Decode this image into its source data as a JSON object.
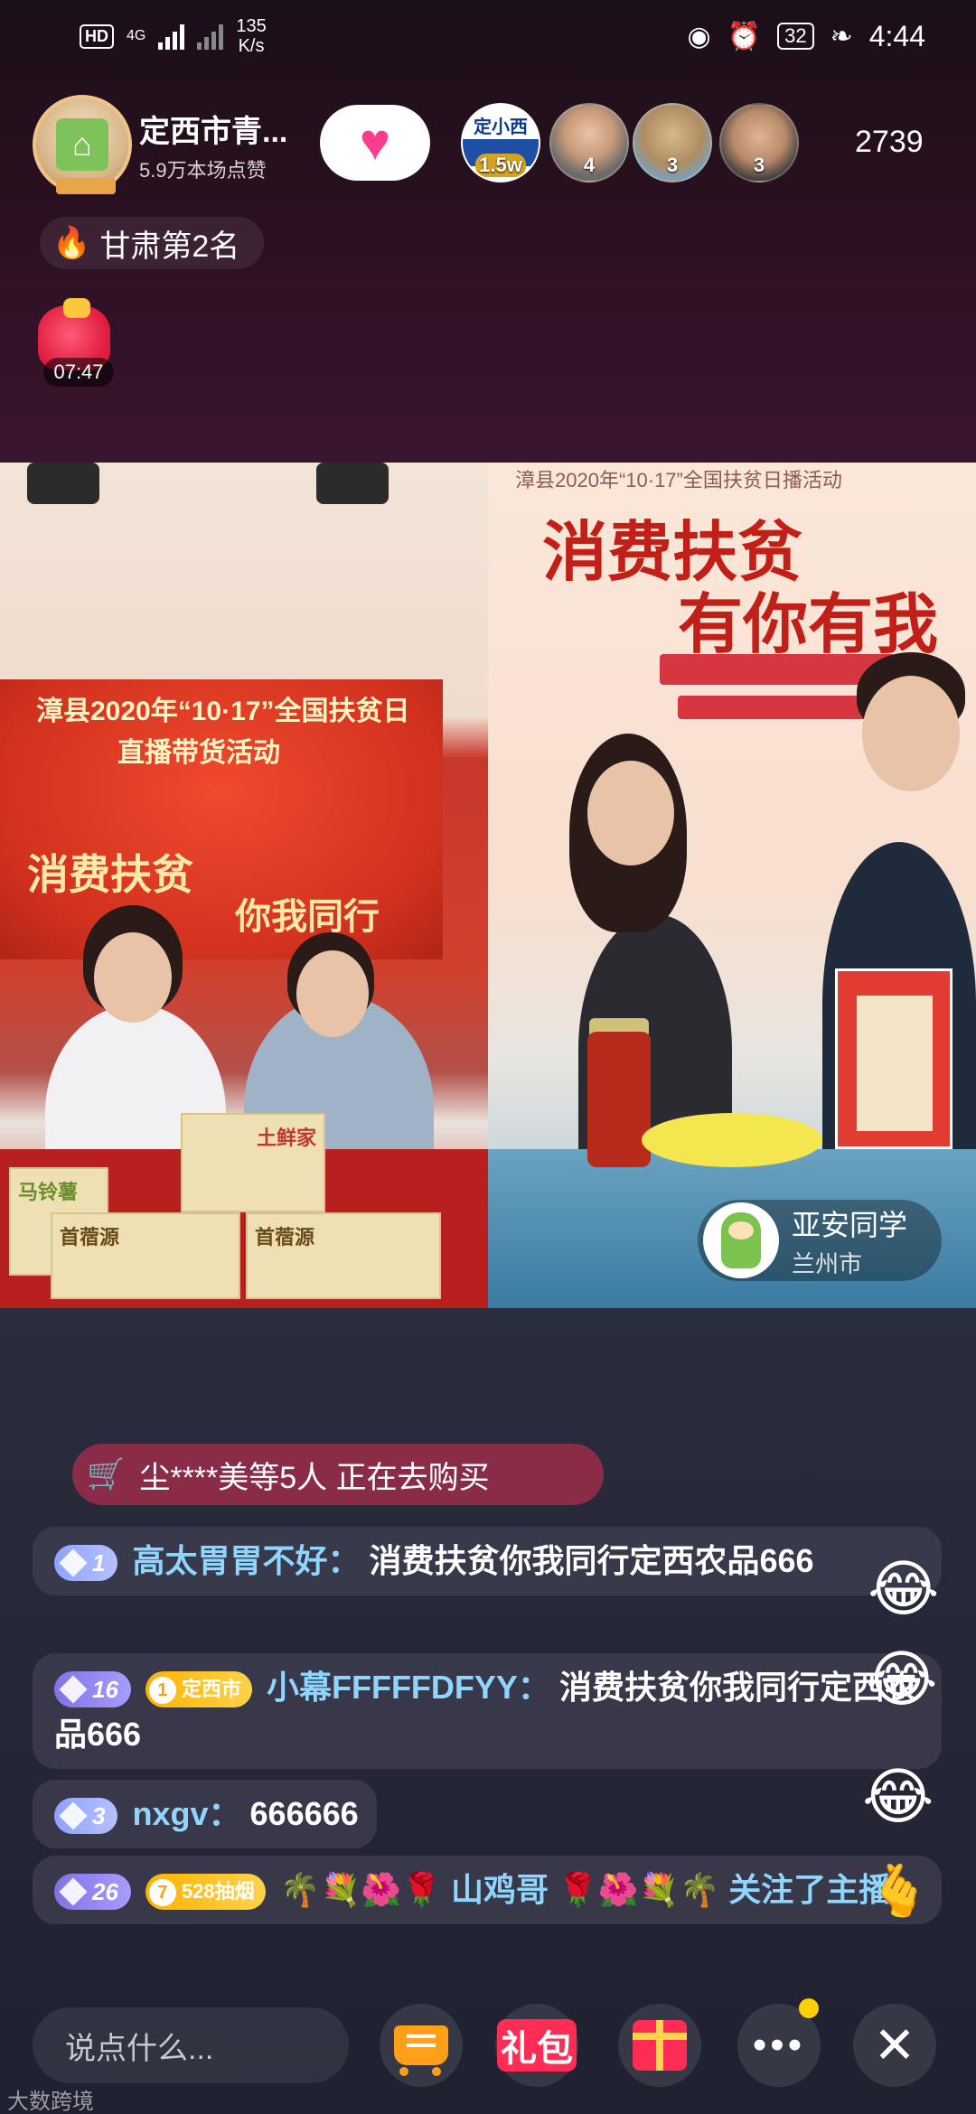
{
  "status_bar": {
    "hd": "HD",
    "network": "4G",
    "speed_value": "135",
    "speed_unit": "K/s",
    "battery": "32",
    "time": "4:44",
    "icons": [
      "eye-icon",
      "alarm-icon",
      "leaf-icon"
    ]
  },
  "header": {
    "host_name": "定西市青...",
    "host_likes": "5.9万本场点赞",
    "follow_icon": "heart-icon",
    "viewers": [
      {
        "label": "定小西",
        "count": "1.5w"
      },
      {
        "count": "4"
      },
      {
        "count": "3"
      },
      {
        "count": "3"
      }
    ],
    "viewer_total": "2739"
  },
  "rank": {
    "icon": "flame-icon",
    "text": "甘肃第2名"
  },
  "red_packet": {
    "timer": "07:47"
  },
  "video_left": {
    "banner_line1": "漳县2020年“10·17”全国扶贫日",
    "banner_line2": "直播带货活动",
    "callig1": "消费扶贫",
    "callig2": "你我同行",
    "product_label1": "马铃薯",
    "product_label2": "土鲜家",
    "product_label3": "首蓿源"
  },
  "video_right": {
    "poster_top": "漳县2020年“10·17”全国扶贫日播活动",
    "poster_title1": "消费扶贫",
    "poster_title2": "有你有我"
  },
  "guest": {
    "name": "亚安同学",
    "city": "兰州市"
  },
  "buying": {
    "icon": "cart-icon",
    "text": "尘****美等5人 正在去购买"
  },
  "chat": [
    {
      "level": "1",
      "fan_badge": "",
      "user": "高太胃胃不好：",
      "message": "消费扶贫你我同行定西农品666"
    },
    {
      "level": "16",
      "fan_badge": "定西市",
      "fan_level": "1",
      "user": "小幕FFFFFDFYY：",
      "message": "消费扶贫你我同行定西农品666"
    },
    {
      "level": "3",
      "fan_badge": "",
      "user": "nxgv：",
      "message": "666666"
    },
    {
      "level": "26",
      "fan_badge": "528抽烟",
      "fan_level": "7",
      "user": "🌴💐🌺🌹 山鸡哥 🌹🌺💐🌴 ",
      "message": "关注了主播"
    }
  ],
  "bottom_bar": {
    "input_placeholder": "说点什么...",
    "gift_text": "礼包",
    "more": "•••",
    "close": "✕"
  },
  "watermark": "大数跨境",
  "colors": {
    "accent_pink": "#ff3d8f",
    "user_name_blue": "#8fd6ff",
    "buy_banner": "#8a2c47",
    "cart_orange": "#ff9f1a"
  }
}
